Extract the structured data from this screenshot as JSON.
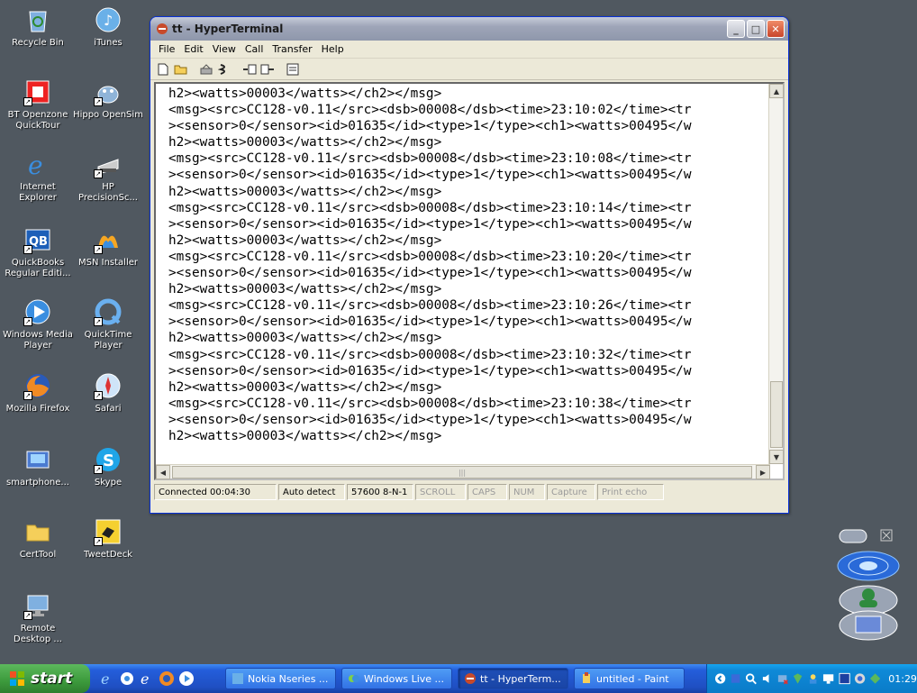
{
  "desktop_icons": [
    {
      "label": "Recycle Bin",
      "icon": "recycle-bin-icon"
    },
    {
      "label": "iTunes",
      "icon": "itunes-icon"
    },
    {
      "label": "BT Openzone QuickTour",
      "icon": "bt-openzone-icon"
    },
    {
      "label": "Hippo OpenSim",
      "icon": "hippo-opensim-icon"
    },
    {
      "label": "Internet Explorer",
      "icon": "internet-explorer-icon"
    },
    {
      "label": "HP PrecisionSc...",
      "icon": "hp-scanner-icon"
    },
    {
      "label": "QuickBooks Regular Editi...",
      "icon": "quickbooks-icon"
    },
    {
      "label": "MSN Installer",
      "icon": "msn-icon"
    },
    {
      "label": "Windows Media Player",
      "icon": "windows-media-player-icon"
    },
    {
      "label": "QuickTime Player",
      "icon": "quicktime-icon"
    },
    {
      "label": "Mozilla Firefox",
      "icon": "firefox-icon"
    },
    {
      "label": "Safari",
      "icon": "safari-icon"
    },
    {
      "label": "smartphone...",
      "icon": "smartphone-icon"
    },
    {
      "label": "Skype",
      "icon": "skype-icon"
    },
    {
      "label": "CertTool",
      "icon": "folder-icon"
    },
    {
      "label": "TweetDeck",
      "icon": "tweetdeck-icon"
    },
    {
      "label": "Remote Desktop ...",
      "icon": "remote-desktop-icon"
    }
  ],
  "window": {
    "title": "tt - HyperTerminal",
    "menu": [
      "File",
      "Edit",
      "View",
      "Call",
      "Transfer",
      "Help"
    ],
    "toolbar": [
      "new-icon",
      "open-icon",
      "connect-icon",
      "disconnect-icon",
      "send-icon",
      "receive-icon",
      "properties-icon"
    ],
    "terminal_lines": [
      "h2><watts>00003</watts></ch2></msg>",
      "<msg><src>CC128-v0.11</src><dsb>00008</dsb><time>23:10:02</time><tr",
      "><sensor>0</sensor><id>01635</id><type>1</type><ch1><watts>00495</w",
      "h2><watts>00003</watts></ch2></msg>",
      "<msg><src>CC128-v0.11</src><dsb>00008</dsb><time>23:10:08</time><tr",
      "><sensor>0</sensor><id>01635</id><type>1</type><ch1><watts>00495</w",
      "h2><watts>00003</watts></ch2></msg>",
      "<msg><src>CC128-v0.11</src><dsb>00008</dsb><time>23:10:14</time><tr",
      "><sensor>0</sensor><id>01635</id><type>1</type><ch1><watts>00495</w",
      "h2><watts>00003</watts></ch2></msg>",
      "<msg><src>CC128-v0.11</src><dsb>00008</dsb><time>23:10:20</time><tr",
      "><sensor>0</sensor><id>01635</id><type>1</type><ch1><watts>00495</w",
      "h2><watts>00003</watts></ch2></msg>",
      "<msg><src>CC128-v0.11</src><dsb>00008</dsb><time>23:10:26</time><tr",
      "><sensor>0</sensor><id>01635</id><type>1</type><ch1><watts>00495</w",
      "h2><watts>00003</watts></ch2></msg>",
      "<msg><src>CC128-v0.11</src><dsb>00008</dsb><time>23:10:32</time><tr",
      "><sensor>0</sensor><id>01635</id><type>1</type><ch1><watts>00495</w",
      "h2><watts>00003</watts></ch2></msg>",
      "<msg><src>CC128-v0.11</src><dsb>00008</dsb><time>23:10:38</time><tr",
      "><sensor>0</sensor><id>01635</id><type>1</type><ch1><watts>00495</w",
      "h2><watts>00003</watts></ch2></msg>"
    ],
    "status": {
      "connected": "Connected 00:04:30",
      "detect": "Auto detect",
      "settings": "57600 8-N-1",
      "scroll": "SCROLL",
      "caps": "CAPS",
      "num": "NUM",
      "capture": "Capture",
      "print_echo": "Print echo"
    }
  },
  "taskbar": {
    "start_label": "start",
    "tasks": [
      {
        "label": "Nokia Nseries ...",
        "icon": "nokia-icon",
        "active": false
      },
      {
        "label": "Windows Live ...",
        "icon": "windows-live-icon",
        "active": false
      },
      {
        "label": "tt - HyperTerm...",
        "icon": "hyperterminal-icon",
        "active": true
      },
      {
        "label": "untitled - Paint",
        "icon": "paint-icon",
        "active": false
      }
    ],
    "clock": "01:29"
  },
  "colors": {
    "desktop": "#505860",
    "taskbar": "#245edb",
    "start": "#3c9a3c",
    "tray": "#0f8ad8"
  }
}
